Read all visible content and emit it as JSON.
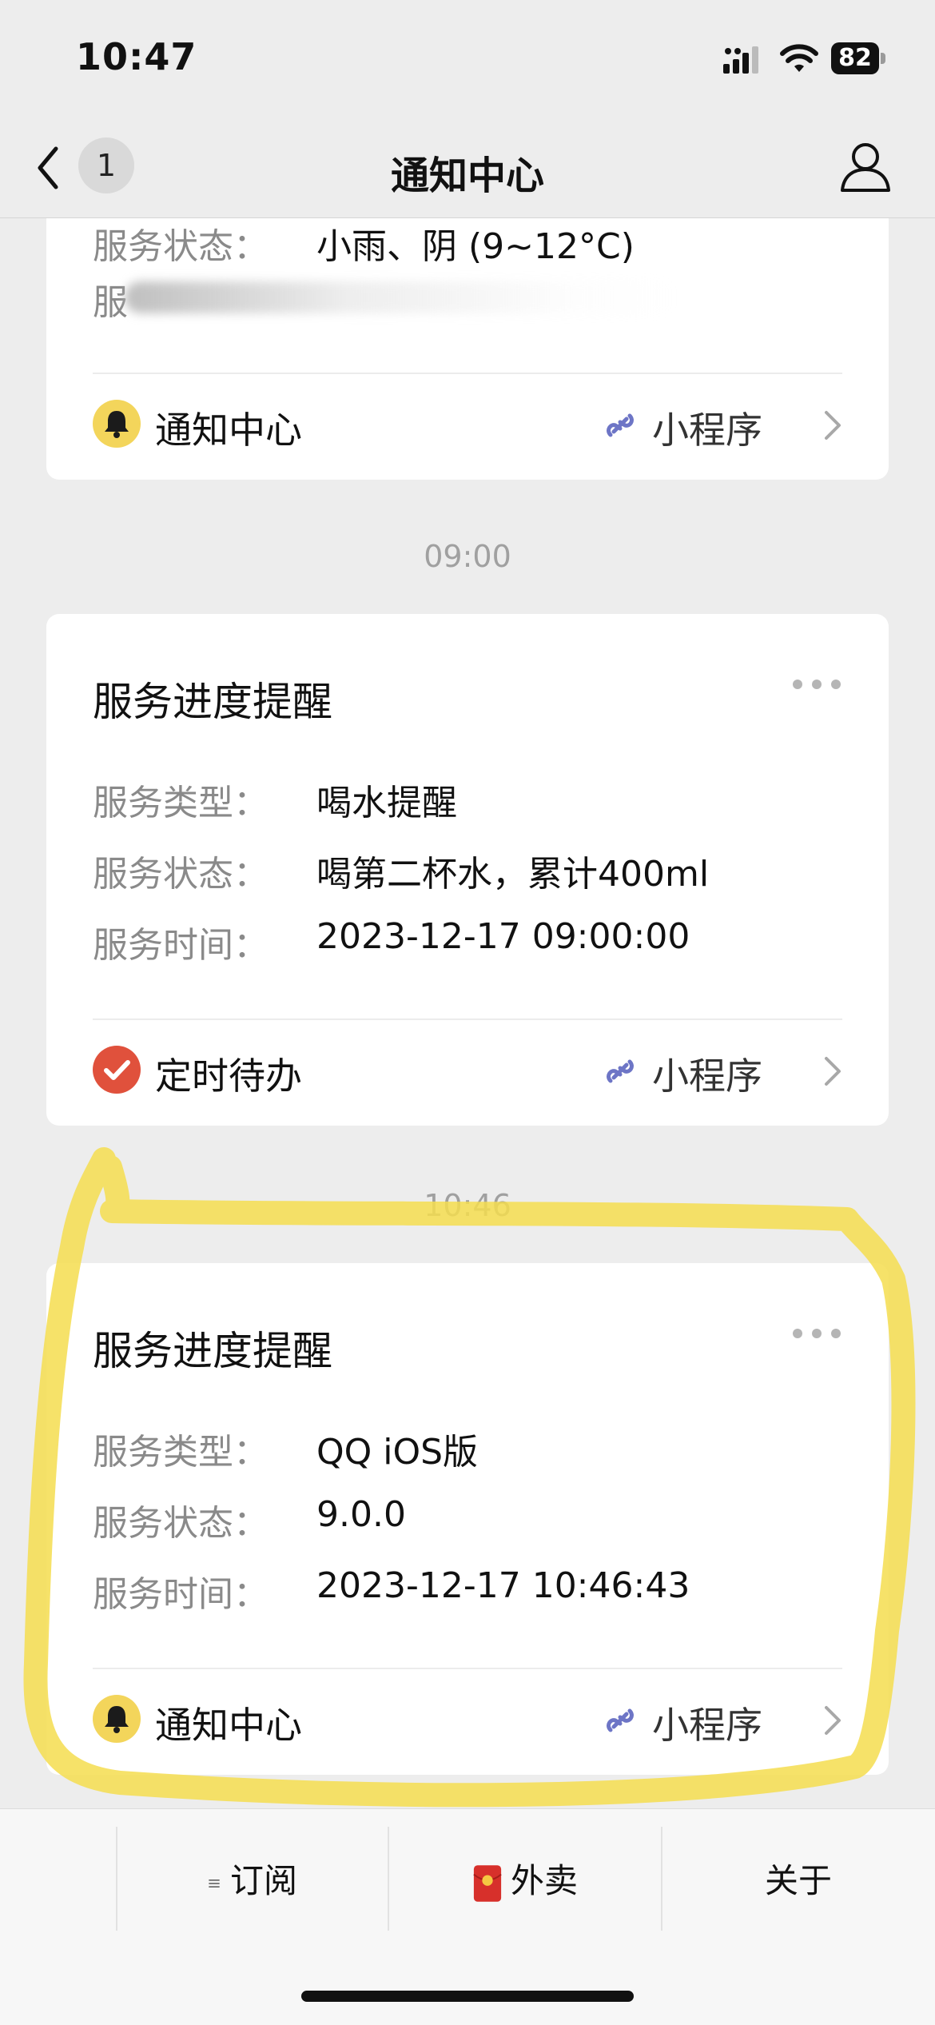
{
  "status_bar": {
    "time": "10:47",
    "battery": "82"
  },
  "nav": {
    "back_count": "1",
    "title": "通知中心"
  },
  "cards": [
    {
      "partial": true,
      "rows": [
        {
          "label": "服务状态：",
          "value": "小雨、阴 (9~12°C)"
        },
        {
          "label": "服"
        }
      ],
      "source_name": "通知中心",
      "source_icon": "bell-icon",
      "mini_program_label": "小程序"
    },
    {
      "time": "09:00",
      "title": "服务进度提醒",
      "rows": [
        {
          "label": "服务类型：",
          "value": "喝水提醒"
        },
        {
          "label": "服务状态：",
          "value": "喝第二杯水，累计400ml"
        },
        {
          "label": "服务时间：",
          "value": "2023-12-17 09:00:00"
        }
      ],
      "source_name": "定时待办",
      "source_icon": "checkmark-icon",
      "mini_program_label": "小程序"
    },
    {
      "time": "10:46",
      "title": "服务进度提醒",
      "rows": [
        {
          "label": "服务类型：",
          "value": "QQ iOS版"
        },
        {
          "label": "服务状态：",
          "value": "9.0.0"
        },
        {
          "label": "服务时间：",
          "value": "2023-12-17 10:46:43"
        }
      ],
      "source_name": "通知中心",
      "source_icon": "bell-icon",
      "mini_program_label": "小程序"
    }
  ],
  "tabs": [
    {
      "label": "订阅",
      "icon": "menu-icon"
    },
    {
      "label": "外卖",
      "icon": "red-envelope-icon"
    },
    {
      "label": "关于"
    }
  ],
  "colors": {
    "background": "#ededed",
    "card": "#ffffff",
    "bell_badge": "#f3d55b",
    "check_badge": "#e0513c",
    "link_icon": "#6d75c6",
    "highlight": "#f5dd4f"
  }
}
